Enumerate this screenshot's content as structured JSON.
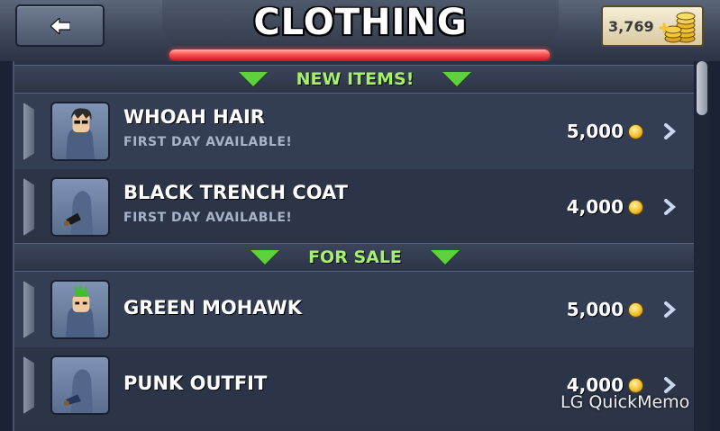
{
  "header": {
    "title": "CLOTHING",
    "back_icon": "back-arrow-icon",
    "coins": "3,769",
    "coin_icon": "gold-coin-stack-icon"
  },
  "sections": [
    {
      "title": "NEW ITEMS!",
      "items": [
        {
          "name": "WHOAH HAIR",
          "subtitle": "FIRST DAY AVAILABLE!",
          "price": "5,000"
        },
        {
          "name": "BLACK TRENCH COAT",
          "subtitle": "FIRST DAY AVAILABLE!",
          "price": "4,000"
        }
      ]
    },
    {
      "title": "FOR SALE",
      "items": [
        {
          "name": "GREEN MOHAWK",
          "price": "5,000"
        },
        {
          "name": "PUNK OUTFIT",
          "price": "4,000"
        }
      ]
    }
  ],
  "watermark": "LG QuickMemo",
  "colors": {
    "section_title": "#a6f06e",
    "accent_triangle": "#5fd13f",
    "title_underline": "#ff5b5b"
  }
}
